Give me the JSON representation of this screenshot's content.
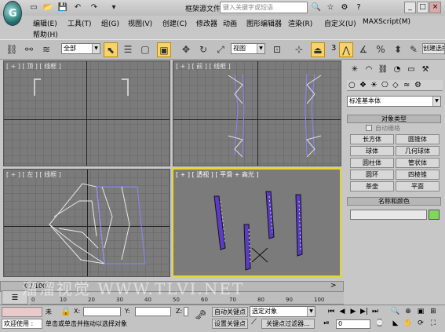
{
  "titlebar": {
    "title": "框架源文件.max",
    "search_placeholder": "键入关键字或短语",
    "icons": [
      "app-logo",
      "new-file-icon",
      "open-file-icon",
      "save-icon",
      "undo-icon",
      "redo-icon",
      "binoculars-icon",
      "star-icon",
      "user-icon",
      "help-icon"
    ],
    "window_buttons": [
      "_",
      "□",
      "×"
    ]
  },
  "menu": {
    "row1": [
      "编辑(E)",
      "工具(T)",
      "组(G)",
      "视图(V)",
      "创建(C)",
      "修改器",
      "动画",
      "图形编辑器",
      "渲染(R)",
      "自定义(U)",
      "MAXScript(M)"
    ],
    "row2": [
      "帮助(H)"
    ]
  },
  "toolbar": {
    "filter_select": "全部",
    "view_select": "视图",
    "snap_number": "3",
    "named_selection_label": "创建选择"
  },
  "viewports": [
    {
      "label": "[ + ] [ 顶 ] [ 线框 ]"
    },
    {
      "label": "[ + ] [ 前 ] [ 线框 ]"
    },
    {
      "label": "[ + ] [ 左 ] [ 线框 ]"
    },
    {
      "label": "[ + ] [ 透视 ] [ 平滑 + 高光 ]"
    }
  ],
  "command_panel": {
    "category_select": "标准基本体",
    "object_type_header": "对象类型",
    "autogrid_label": "自动栅格",
    "buttons": [
      "长方体",
      "圆锥体",
      "球体",
      "几何球体",
      "圆柱体",
      "管状体",
      "圆环",
      "四棱锥",
      "茶壶",
      "平面"
    ],
    "name_color_header": "名称和颜色",
    "swatch_color": "#7ed957"
  },
  "timeline": {
    "frame_display": "0 / 100",
    "ticks": [
      "0",
      "10",
      "20",
      "30",
      "40",
      "50",
      "60",
      "70",
      "80",
      "90",
      "100"
    ]
  },
  "status": {
    "welcome": "欢迎使用 :",
    "selection_label": "未",
    "x_label": "X:",
    "y_label": "Y:",
    "z_label": "Z:",
    "auto_key": "自动关键点",
    "set_key": "设置关键点",
    "selected_object": "选定对象",
    "key_filters": "关键点过滤器...",
    "prompt": "单击或单击并拖动以选择对象",
    "frame_field": "0"
  },
  "watermark": "溜溜视觉 WWW.TLVI.NET"
}
